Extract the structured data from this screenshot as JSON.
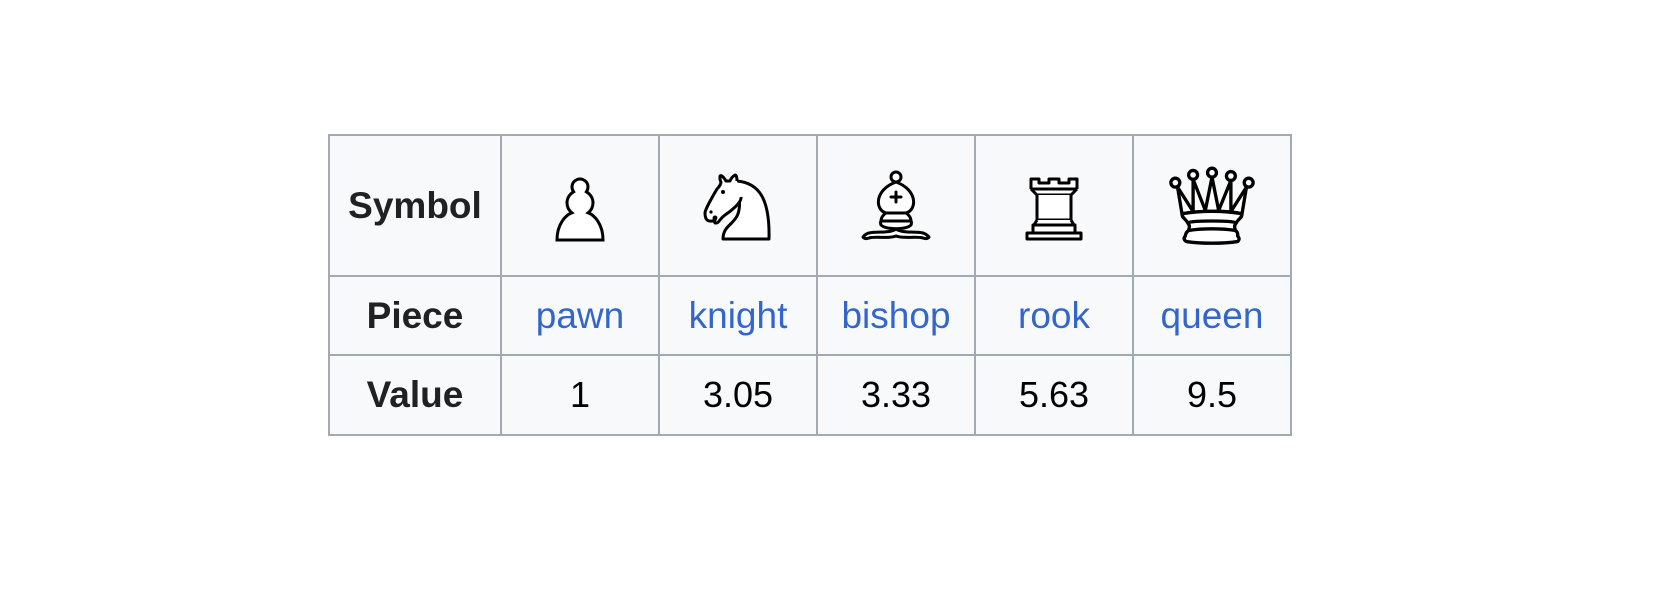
{
  "table": {
    "row_headers": [
      "Symbol",
      "Piece",
      "Value"
    ],
    "pieces": [
      {
        "icon": "white-pawn-icon",
        "name": "pawn",
        "value": "1"
      },
      {
        "icon": "white-knight-icon",
        "name": "knight",
        "value": "3.05"
      },
      {
        "icon": "white-bishop-icon",
        "name": "bishop",
        "value": "3.33"
      },
      {
        "icon": "white-rook-icon",
        "name": "rook",
        "value": "5.63"
      },
      {
        "icon": "white-queen-icon",
        "name": "queen",
        "value": "9.5"
      }
    ]
  },
  "colors": {
    "link": "#3366cc",
    "border": "#a2a9b1",
    "cell_bg": "#f8f9fa",
    "header_text": "#202122"
  }
}
